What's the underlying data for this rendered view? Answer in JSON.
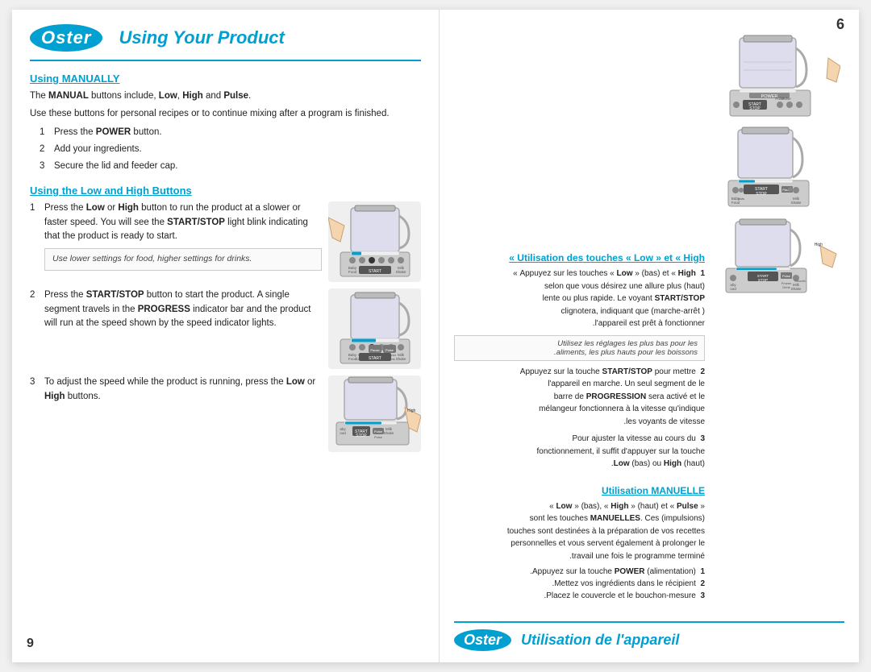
{
  "page": {
    "number_top": "6",
    "number_bottom": "9"
  },
  "left": {
    "logo_text": "Oster",
    "title": "Using Your Product",
    "section1": {
      "heading": "Using MANUALLY",
      "intro": "The MANUAL buttons include, Low, High and Pulse.",
      "subtext": "Use these buttons for personal recipes or to continue mixing after a program is finished.",
      "steps": [
        {
          "num": "1",
          "text": "Press the POWER button."
        },
        {
          "num": "2",
          "text": "Add your ingredients."
        },
        {
          "num": "3",
          "text": "Secure the lid and feeder cap."
        }
      ]
    },
    "section2": {
      "heading": "Using the Low and High Buttons",
      "step1_text": "Press the Low or High button to run the product at a slower or faster speed. You will see the START/STOP light blink indicating that the product is ready to start.",
      "note": "Use lower settings for food, higher settings for drinks.",
      "step2_text": "Press the START/STOP button to start the product. A single segment travels in the PROGRESS indicator bar and the product will run at the speed shown by the speed indicator lights.",
      "step3_text": "To adjust the speed while the product is running, press the Low or High buttons."
    }
  },
  "right": {
    "logo_text": "Oster",
    "title": "Utilisation de l'appareil",
    "section_manual": {
      "heading": "Utilisation MANUELLE",
      "lines": [
        "« Low » (bas), « High » (haut) et « Pulse »",
        "(impulsions) sont les touches MANUELLES. Ces",
        "touches sont destinées à la préparation de vos recettes",
        "personnelles et vous servent également à prolonger le",
        "travail une fois le programme terminé."
      ],
      "steps": [
        {
          "num": "1",
          "text": "Appuyez sur la touche POWER (alimentation)."
        },
        {
          "num": "2",
          "text": "Mettez vos ingrédients dans le récipient."
        },
        {
          "num": "3",
          "text": "Placez le couvercle et le bouchon-mesure."
        }
      ]
    },
    "section_lowhigh": {
      "heading": "Utilisation des touches « Low » et « High »",
      "step1_lines": [
        "Appuyez sur les touches « Low » (bas) et « High »",
        "(haut) selon que vous désirez une allure plus",
        "lente ou plus rapide. Le voyant START/STOP",
        "( marche-arrêt) clignotera, indiquant que",
        "l'appareil est prêt à fonctionner."
      ],
      "note_lines": [
        "Utilisez les réglages les plus bas pour les",
        "aliments, les plus hauts pour les boissons."
      ],
      "step2_lines": [
        "Appuyez sur la touche START/STOP pour mettre",
        "l'appareil en marche. Un seul segment de le",
        "barre de PROGRESSION sera activé et le",
        "mélangeur fonctionnera à la vitesse qu'indique",
        "les voyants de vitesse."
      ],
      "step3_lines": [
        "Pour ajuster la vitesse au cours du",
        "fonctionnement, il suffit d'appuyer sur la touche",
        "Low (bas) ou High (haut)."
      ]
    }
  }
}
